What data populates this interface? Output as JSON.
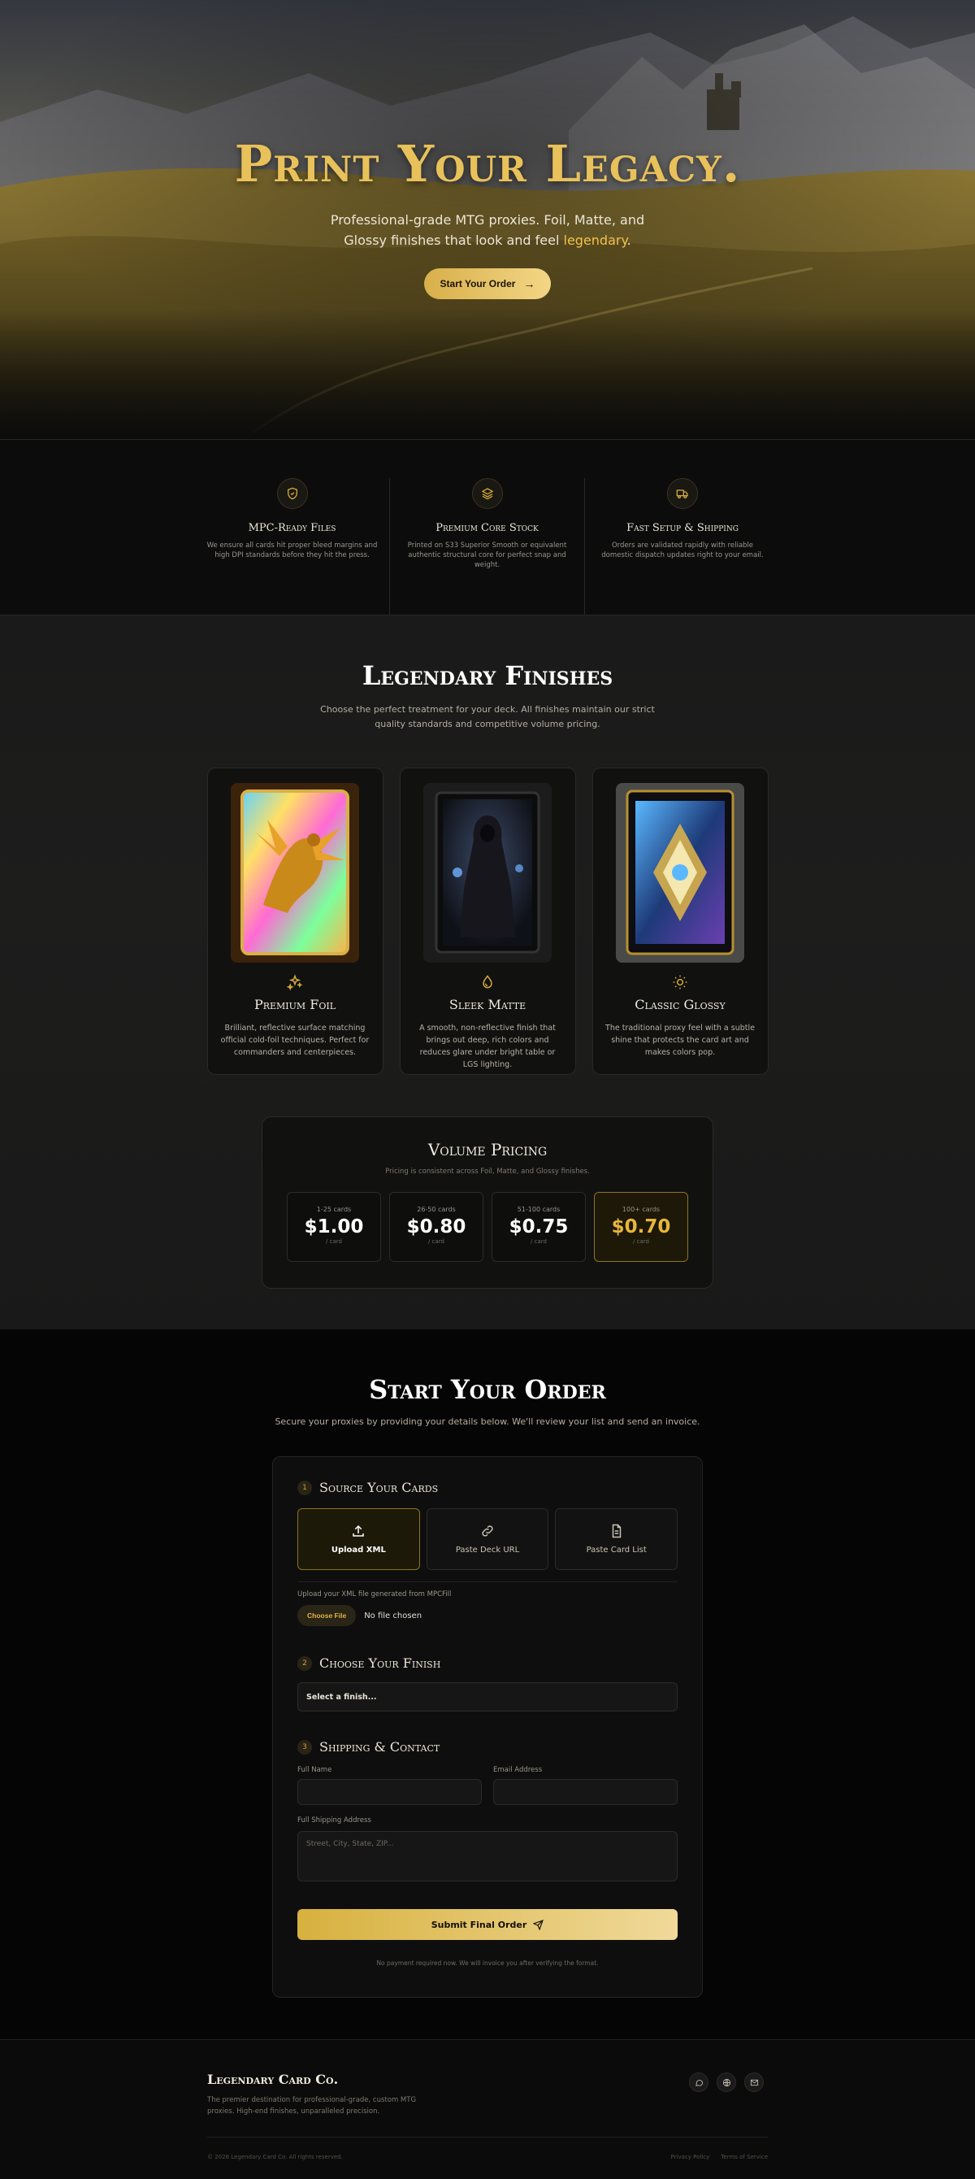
{
  "hero": {
    "title": "Print Your Legacy.",
    "subtitle_main": "Professional-grade MTG proxies. Foil, Matte, and Glossy finishes that look and feel ",
    "subtitle_highlight": "legendary",
    "subtitle_end": ".",
    "cta_label": "Start Your Order"
  },
  "features": [
    {
      "icon": "shield-icon",
      "title": "MPC-Ready Files",
      "text": "We ensure all cards hit proper bleed margins and high DPI standards before they hit the press."
    },
    {
      "icon": "layers-icon",
      "title": "Premium Core Stock",
      "text": "Printed on S33 Superior Smooth or equivalent authentic structural core for perfect snap and weight."
    },
    {
      "icon": "truck-icon",
      "title": "Fast Setup & Shipping",
      "text": "Orders are validated rapidly with reliable domestic dispatch updates right to your email."
    }
  ],
  "finishes": {
    "title": "Legendary Finishes",
    "subtitle": "Choose the perfect treatment for your deck. All finishes maintain our strict quality standards and competitive volume pricing.",
    "cards": [
      {
        "icon": "sparkles-icon",
        "title": "Premium Foil",
        "text": "Brilliant, reflective surface matching official cold-foil techniques. Perfect for commanders and centerpieces."
      },
      {
        "icon": "droplet-icon",
        "title": "Sleek Matte",
        "text": "A smooth, non-reflective finish that brings out deep, rich colors and reduces glare under bright table or LGS lighting."
      },
      {
        "icon": "sun-icon",
        "title": "Classic Glossy",
        "text": "The traditional proxy feel with a subtle shine that protects the card art and makes colors pop."
      }
    ]
  },
  "volume": {
    "title": "Volume Pricing",
    "subtitle": "Pricing is consistent across Foil, Matte, and Glossy finishes.",
    "tiers": [
      {
        "range": "1-25 cards",
        "price": "$1.00",
        "unit": "/ card"
      },
      {
        "range": "26-50 cards",
        "price": "$0.80",
        "unit": "/ card"
      },
      {
        "range": "51-100 cards",
        "price": "$0.75",
        "unit": "/ card"
      },
      {
        "range": "100+ cards",
        "price": "$0.70",
        "unit": "/ card"
      }
    ]
  },
  "order": {
    "title": "Start Your Order",
    "subtitle": "Secure your proxies by providing your details below. We'll review your list and send an invoice.",
    "step1": {
      "num": "1",
      "title": "Source Your Cards"
    },
    "sources": [
      {
        "icon": "upload-icon",
        "label": "Upload XML"
      },
      {
        "icon": "link-icon",
        "label": "Paste Deck URL"
      },
      {
        "icon": "document-icon",
        "label": "Paste Card List"
      }
    ],
    "upload_label": "Upload your XML file generated from MPCFill",
    "choose_file": "Choose File",
    "no_file": "No file chosen",
    "step2": {
      "num": "2",
      "title": "Choose Your Finish"
    },
    "finish_select": "Select a finish...",
    "step3": {
      "num": "3",
      "title": "Shipping & Contact"
    },
    "full_name_label": "Full Name",
    "email_label": "Email Address",
    "address_label": "Full Shipping Address",
    "address_placeholder": "Street, City, State, ZIP...",
    "submit_label": "Submit Final Order",
    "note": "No payment required now. We will invoice you after verifying the format."
  },
  "footer": {
    "brand": "Legendary Card Co.",
    "desc": "The premier destination for professional-grade, custom MTG proxies. High-end finishes, unparalleled precision.",
    "copyright": "© 2026 Legendary Card Co. All rights reserved.",
    "privacy": "Privacy Policy",
    "terms": "Terms of Service"
  },
  "colors": {
    "gold": "#e8c15a",
    "accent": "#e7b63a",
    "background": "#0b0b0b"
  }
}
